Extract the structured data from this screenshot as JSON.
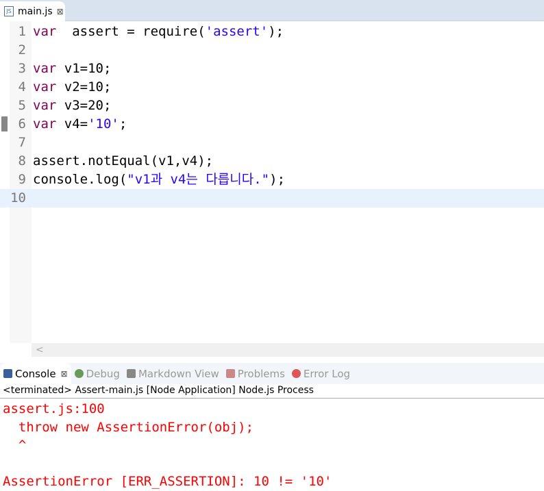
{
  "editor_tab": {
    "title": "main.js",
    "close": "⊠"
  },
  "lines": [
    {
      "n": "1",
      "parts": [
        [
          "kw",
          "var"
        ],
        [
          "",
          "  assert = require("
        ],
        [
          "str",
          "'assert'"
        ],
        [
          "",
          ");"
        ]
      ]
    },
    {
      "n": "2",
      "parts": []
    },
    {
      "n": "3",
      "parts": [
        [
          "kw",
          "var"
        ],
        [
          "",
          " v1=10;"
        ]
      ]
    },
    {
      "n": "4",
      "parts": [
        [
          "kw",
          "var"
        ],
        [
          "",
          " v2=10;"
        ]
      ]
    },
    {
      "n": "5",
      "parts": [
        [
          "kw",
          "var"
        ],
        [
          "",
          " v3=20;"
        ]
      ]
    },
    {
      "n": "6",
      "parts": [
        [
          "kw",
          "var"
        ],
        [
          "",
          " v4="
        ],
        [
          "str",
          "'10'"
        ],
        [
          "",
          ";"
        ]
      ]
    },
    {
      "n": "7",
      "parts": []
    },
    {
      "n": "8",
      "parts": [
        [
          "",
          "assert.notEqual(v1,v4);"
        ]
      ]
    },
    {
      "n": "9",
      "parts": [
        [
          "",
          "console.log("
        ],
        [
          "str",
          "\"v1과 v4는 다릅니다.\""
        ],
        [
          "",
          ");"
        ]
      ]
    },
    {
      "n": "10",
      "parts": []
    }
  ],
  "scroll_left": "<",
  "panel_tabs": [
    {
      "label": "Console",
      "icon": "console-icon",
      "close": "⊠",
      "active": true
    },
    {
      "label": "Debug",
      "icon": "bug-icon"
    },
    {
      "label": "Markdown View",
      "icon": "document-icon"
    },
    {
      "label": "Problems",
      "icon": "problems-icon"
    },
    {
      "label": "Error Log",
      "icon": "error-log-icon"
    }
  ],
  "console_status": "<terminated> Assert-main.js [Node Application] Node.js Process",
  "output": [
    "assert.js:100",
    "  throw new AssertionError(obj);",
    "  ^",
    "",
    "AssertionError [ERR_ASSERTION]: 10 != '10'"
  ],
  "colors": {
    "keyword": "#7f0055",
    "string": "#2a00ff",
    "error": "#ff0000"
  }
}
